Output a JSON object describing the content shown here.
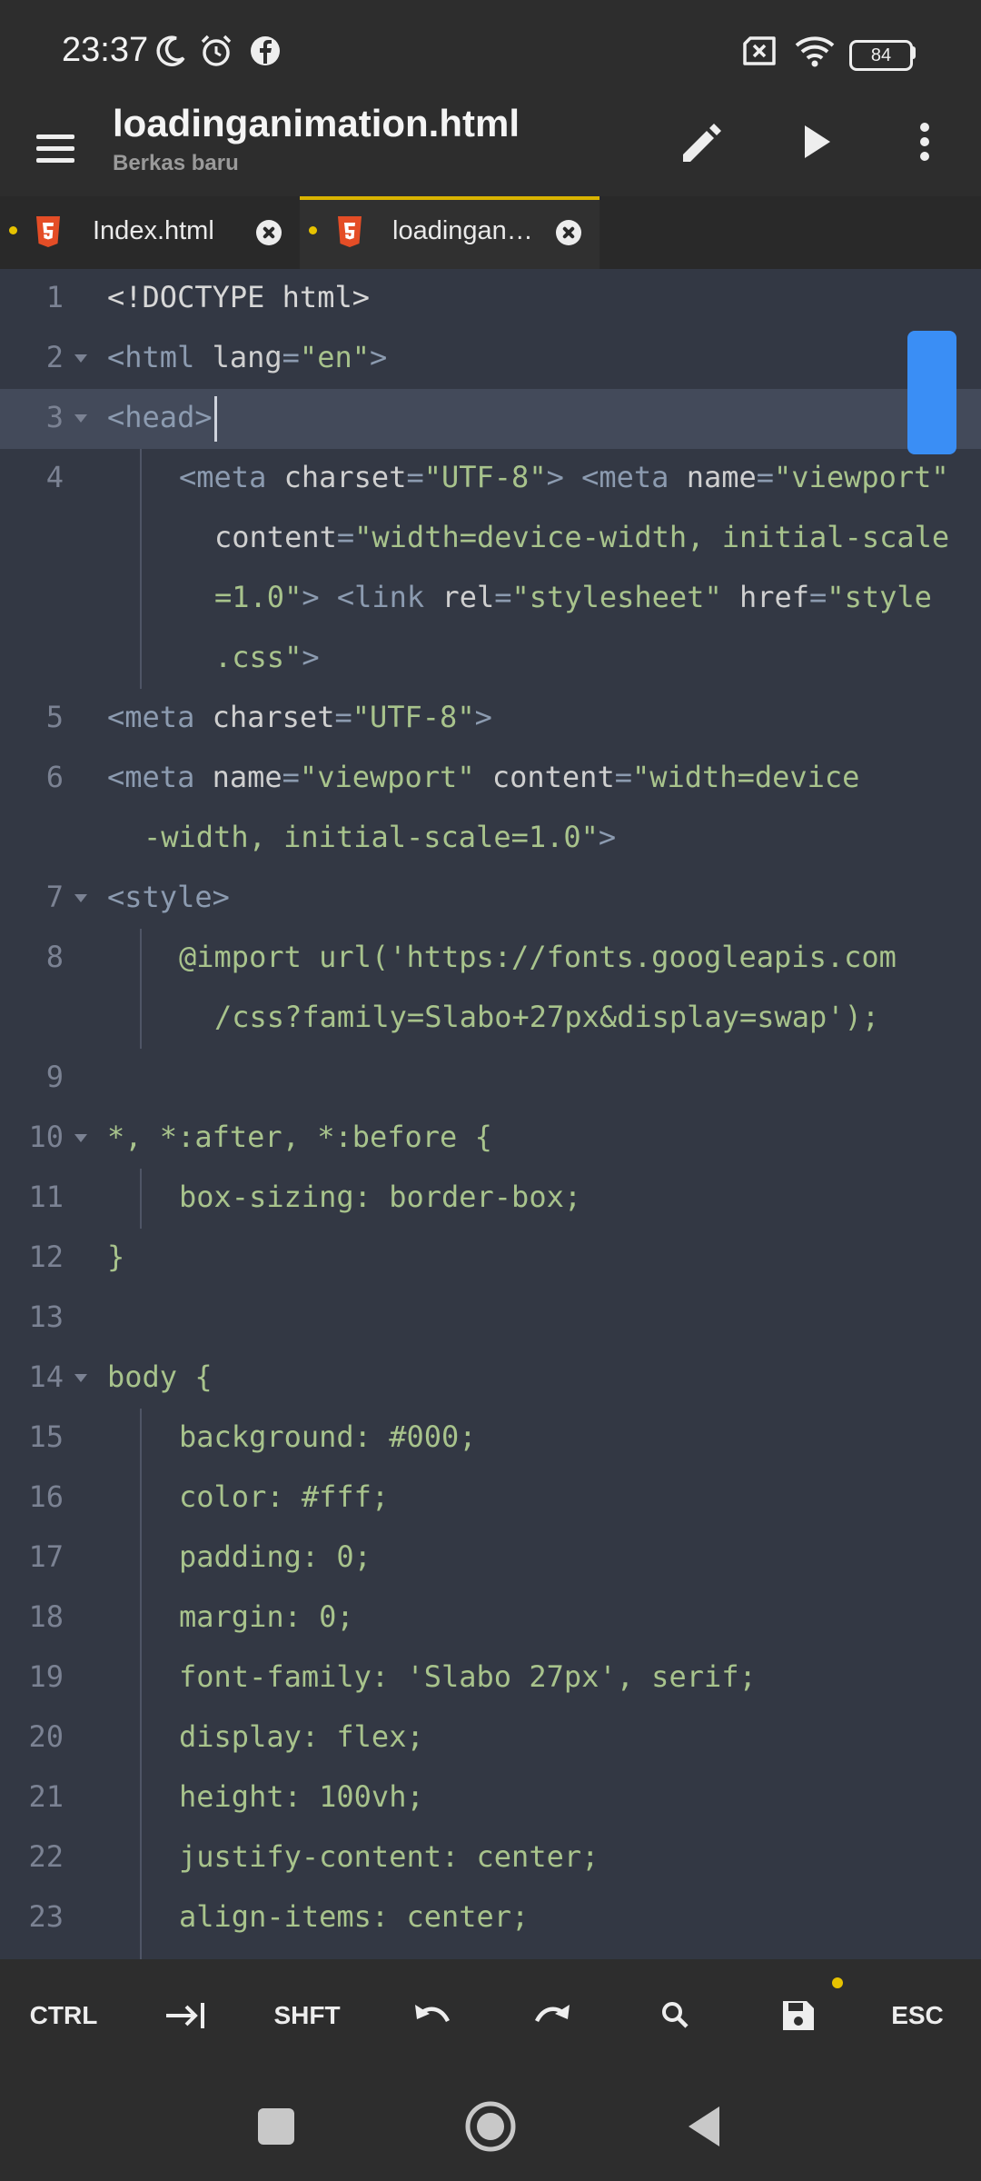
{
  "status": {
    "time": "23:37",
    "battery": "84"
  },
  "appbar": {
    "title": "loadinganimation.html",
    "subtitle": "Berkas baru"
  },
  "tabs": [
    {
      "label": "Index.html"
    },
    {
      "label": "loadingan…"
    }
  ],
  "editor": {
    "lines": [
      {
        "num": "1"
      },
      {
        "num": "2"
      },
      {
        "num": "3"
      },
      {
        "num": "4"
      },
      {
        "num": "5"
      },
      {
        "num": "6"
      },
      {
        "num": "7"
      },
      {
        "num": "8"
      },
      {
        "num": "9"
      },
      {
        "num": "10"
      },
      {
        "num": "11"
      },
      {
        "num": "12"
      },
      {
        "num": "13"
      },
      {
        "num": "14"
      },
      {
        "num": "15"
      },
      {
        "num": "16"
      },
      {
        "num": "17"
      },
      {
        "num": "18"
      },
      {
        "num": "19"
      },
      {
        "num": "20"
      },
      {
        "num": "21"
      },
      {
        "num": "22"
      },
      {
        "num": "23"
      }
    ],
    "code": {
      "l1": "<!DOCTYPE html>",
      "l2_tag": "<html",
      "l2_attr": " lang",
      "l2_eq": "=",
      "l2_val": "\"en\"",
      "l2_end": ">",
      "l3": "<head>",
      "l4a_tag": "<meta",
      "l4a_attr": " charset",
      "l4a_eq": "=",
      "l4a_val": "\"UTF-8\"",
      "l4a_end": ">",
      "l4a_tag2": " <meta",
      "l4a_attr2": " name",
      "l4a_eq2": "=",
      "l4a_val2": "\"viewport\"",
      "l4b_attr": "content",
      "l4b_eq": "=",
      "l4b_val": "\"width=device-width, initial-scale",
      "l4c_val": "=1.0\"",
      "l4c_end": ">",
      "l4c_tag": " <link",
      "l4c_attr": " rel",
      "l4c_eq": "=",
      "l4c_val2": "\"stylesheet\"",
      "l4c_attr2": " href",
      "l4c_eq2": "=",
      "l4c_val3": "\"style",
      "l4d_val": ".css\"",
      "l4d_end": ">",
      "l5_tag": "<meta",
      "l5_attr": " charset",
      "l5_eq": "=",
      "l5_val": "\"UTF-8\"",
      "l5_end": ">",
      "l6a_tag": "<meta",
      "l6a_attr": " name",
      "l6a_eq": "=",
      "l6a_val": "\"viewport\"",
      "l6a_attr2": " content",
      "l6a_eq2": "=",
      "l6a_val2": "\"width=device",
      "l6b_val": "-width, initial-scale=1.0\"",
      "l6b_end": ">",
      "l7": "<style>",
      "l8a": "@import url('https://fonts.googleapis.com",
      "l8b": "/css?family=Slabo+27px&display=swap');",
      "l10": "*, *:after, *:before {",
      "l11": "box-sizing: border-box;",
      "l12": "}",
      "l14": "body {",
      "l15": "background: #000;",
      "l16": "color: #fff;",
      "l17": "padding: 0;",
      "l18": "margin: 0;",
      "l19": "font-family: 'Slabo 27px', serif;",
      "l20": "display: flex;",
      "l21": "height: 100vh;",
      "l22": "justify-content: center;",
      "l23": "align-items: center;"
    }
  },
  "keys": {
    "ctrl": "CTRL",
    "shift": "SHFT",
    "esc": "ESC"
  },
  "colors": {
    "accent": "#3a8ef5",
    "tab_indicator": "#d9b300",
    "modified_dot": "#e6c200",
    "html5": "#e44d26"
  }
}
